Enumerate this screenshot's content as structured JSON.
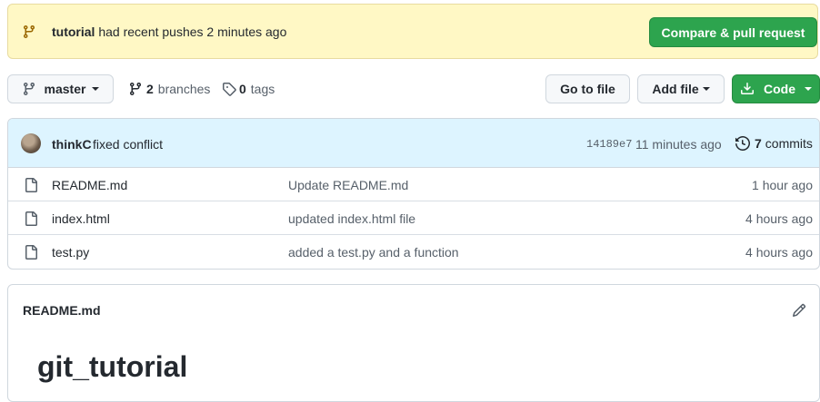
{
  "banner": {
    "branch_name": "tutorial",
    "message": " had recent pushes 2 minutes ago",
    "compare_button": "Compare & pull request"
  },
  "toolbar": {
    "branch_selector": "master",
    "branches_count": "2",
    "branches_label": "branches",
    "tags_count": "0",
    "tags_label": "tags",
    "go_to_file": "Go to file",
    "add_file": "Add file",
    "code": "Code"
  },
  "commit": {
    "author": "thinkC",
    "message": "fixed conflict",
    "sha": "14189e7",
    "time": "11 minutes ago",
    "commits_count": "7",
    "commits_label": "commits"
  },
  "files": [
    {
      "name": "README.md",
      "message": "Update README.md",
      "time": "1 hour ago"
    },
    {
      "name": "index.html",
      "message": "updated index.html file",
      "time": "4 hours ago"
    },
    {
      "name": "test.py",
      "message": "added a test.py and a function",
      "time": "4 hours ago"
    }
  ],
  "readme": {
    "header": "README.md",
    "heading": "git_tutorial"
  },
  "colors": {
    "banner_bg": "#fff8c5",
    "primary_green": "#2da44e",
    "commit_bar_bg": "#ddf4ff",
    "branch_icon": "#9a6700"
  },
  "icons": [
    "git-branch-icon",
    "tag-icon",
    "download-icon",
    "history-icon",
    "file-icon",
    "pencil-icon"
  ]
}
